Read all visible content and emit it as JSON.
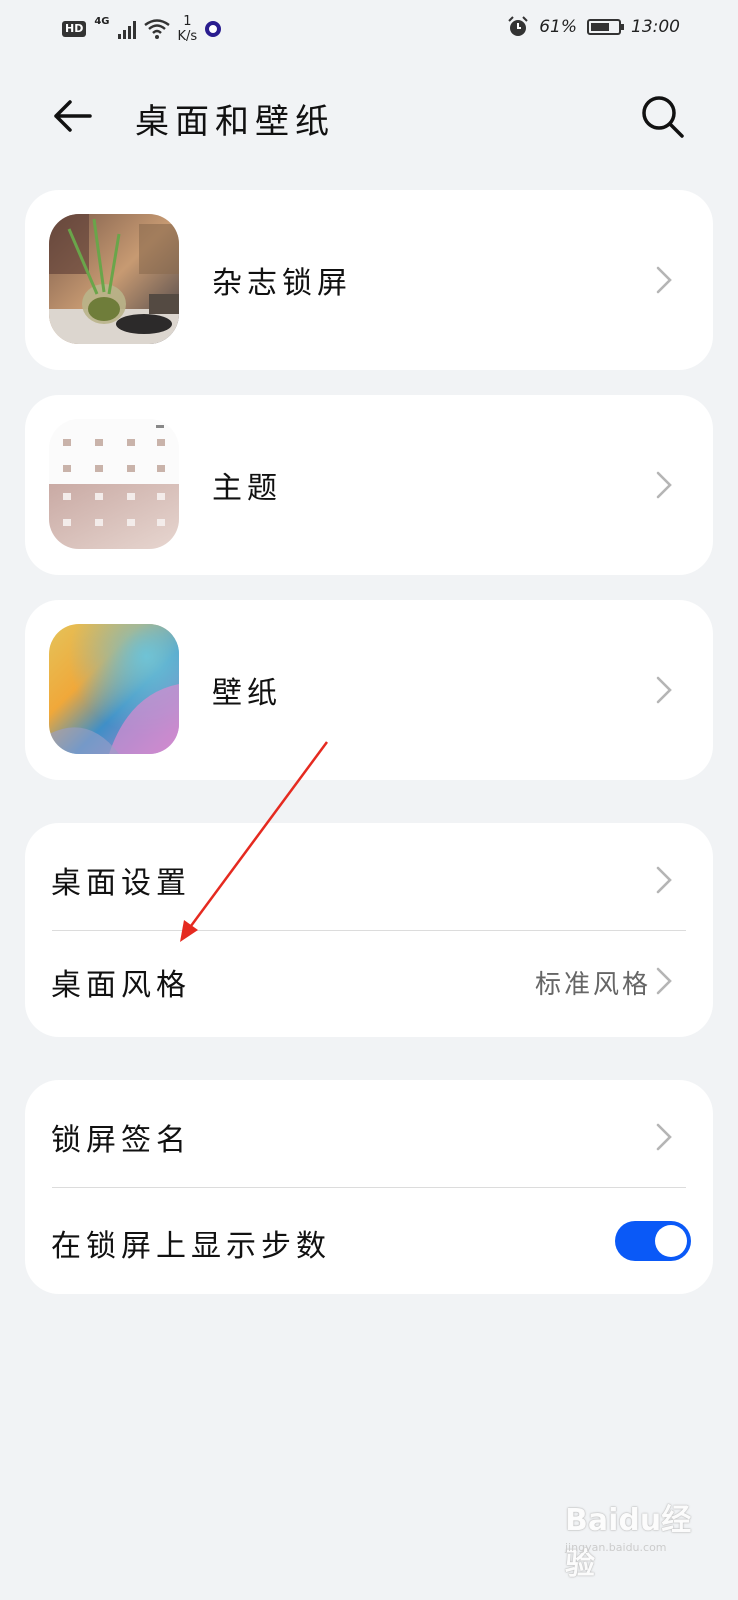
{
  "status_bar": {
    "hd": "HD",
    "network": "4G",
    "speed_value": "1",
    "speed_unit": "K/s",
    "battery": "61%",
    "time": "13:00"
  },
  "header": {
    "title": "桌面和壁纸"
  },
  "cards": {
    "magazine_lock": {
      "label": "杂志锁屏"
    },
    "theme": {
      "label": "主题"
    },
    "wallpaper": {
      "label": "壁纸"
    }
  },
  "desktop_group": {
    "desktop_settings": {
      "label": "桌面设置"
    },
    "desktop_style": {
      "label": "桌面风格",
      "value": "标准风格"
    }
  },
  "lock_group": {
    "lock_signature": {
      "label": "锁屏签名"
    },
    "show_steps": {
      "label": "在锁屏上显示步数",
      "enabled": true
    }
  },
  "colors": {
    "accent": "#0a59f7",
    "background": "#f1f3f5",
    "annotation": "#e52a20"
  },
  "watermark": {
    "text": "Baidu经验",
    "sub": "jingyan.baidu.com"
  }
}
